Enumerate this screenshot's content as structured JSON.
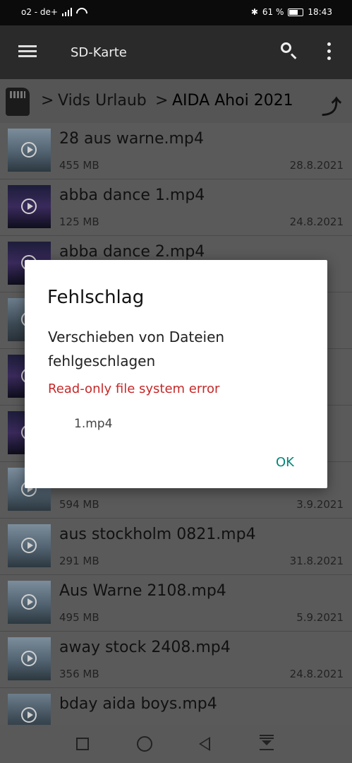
{
  "status": {
    "carrier": "o2 - de+",
    "battery": "61 %",
    "time": "18:43"
  },
  "appbar": {
    "title": "SD-Karte"
  },
  "breadcrumb": {
    "sep1": ">",
    "folder1": "Vids Urlaub",
    "sep2": ">",
    "folder2": "AIDA Ahoi 2021"
  },
  "files": [
    {
      "name": "28 aus warne.mp4",
      "size": "455 MB",
      "date": "28.8.2021"
    },
    {
      "name": "abba dance 1.mp4",
      "size": "125 MB",
      "date": "24.8.2021"
    },
    {
      "name": "abba dance 2.mp4",
      "size": "",
      "date": ""
    },
    {
      "name": "",
      "size": "",
      "date": ""
    },
    {
      "name": "",
      "size": "",
      "date": ""
    },
    {
      "name": "",
      "size": "",
      "date": ""
    },
    {
      "name": "",
      "size": "594 MB",
      "date": "3.9.2021"
    },
    {
      "name": "aus stockholm 0821.mp4",
      "size": "291 MB",
      "date": "31.8.2021"
    },
    {
      "name": "Aus Warne 2108.mp4",
      "size": "495 MB",
      "date": "5.9.2021"
    },
    {
      "name": "away stock 2408.mp4",
      "size": "356 MB",
      "date": "24.8.2021"
    },
    {
      "name": "bday aida boys.mp4",
      "size": "",
      "date": ""
    }
  ],
  "dialog": {
    "title": "Fehlschlag",
    "message": "Verschieben von Dateien fehlgeschlagen",
    "error": "Read-only file system error",
    "file": "1.mp4",
    "ok": "OK"
  }
}
